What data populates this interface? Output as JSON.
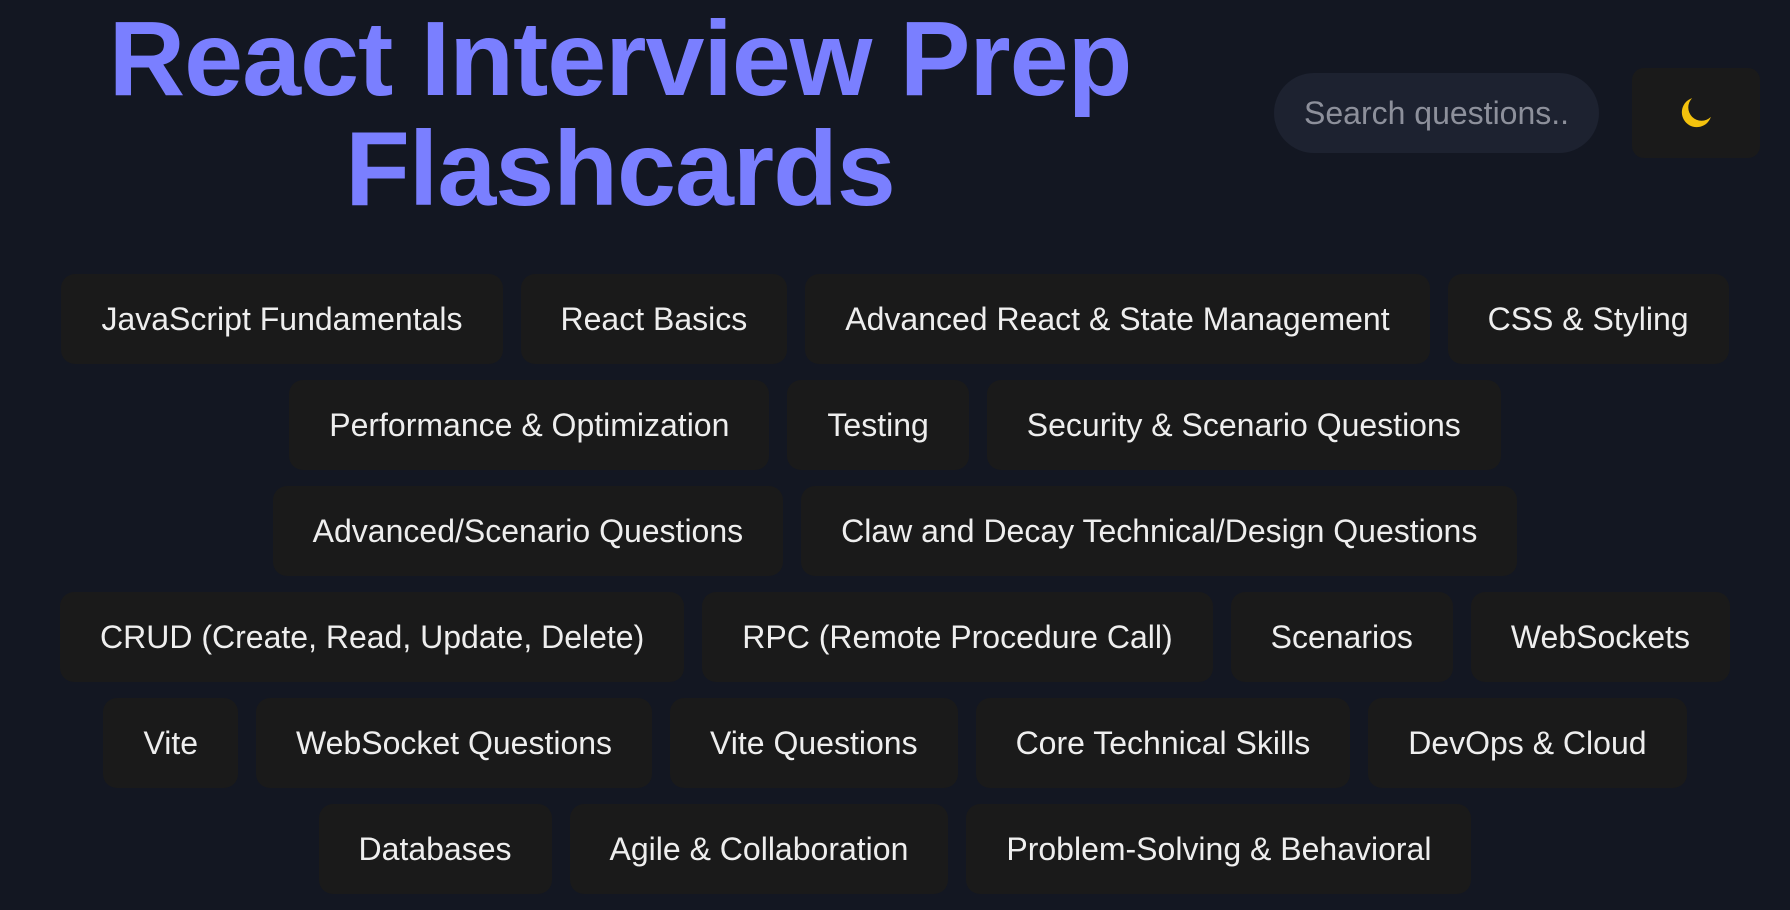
{
  "header": {
    "title_line1": "React Interview Prep",
    "title_line2": "Flashcards",
    "search_placeholder": "Search questions...",
    "theme_toggle": {
      "icon": "moon-icon",
      "icon_color": "#f4c20d"
    }
  },
  "colors": {
    "background": "#131722",
    "title": "#7a7fff",
    "chip_background": "#1a1a1a",
    "chip_text": "#eeeeee"
  },
  "categories": [
    "JavaScript Fundamentals",
    "React Basics",
    "Advanced React & State Management",
    "CSS & Styling",
    "Performance & Optimization",
    "Testing",
    "Security & Scenario Questions",
    "Advanced/Scenario Questions",
    "Claw and Decay Technical/Design Questions",
    "CRUD (Create, Read, Update, Delete)",
    "RPC (Remote Procedure Call)",
    "Scenarios",
    "WebSockets",
    "Vite",
    "WebSocket Questions",
    "Vite Questions",
    "Core Technical Skills",
    "DevOps & Cloud",
    "Databases",
    "Agile & Collaboration",
    "Problem-Solving & Behavioral"
  ]
}
